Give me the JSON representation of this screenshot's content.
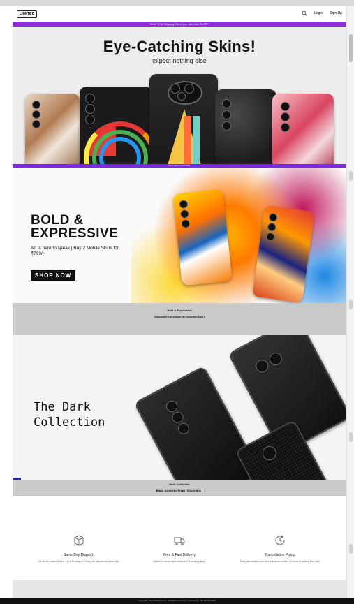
{
  "header": {
    "logo": "LIMITED",
    "login": "Login",
    "signup": "Sign Up"
  },
  "banner": {
    "shipping": "World Wide Shipping, Order your skin from Rs 299 !"
  },
  "hero1": {
    "title": "Eye-Catching Skins!",
    "subtitle": "expect nothing else"
  },
  "bestbar": {
    "text": "Best Skins of the Year"
  },
  "hero2": {
    "title_line1": "BOLD &",
    "title_line2": "EXPRESSIVE",
    "tagline": "Art is here to speak | Buy 2 Mobile Skins for ₹799/-",
    "cta": "SHOP NOW",
    "caption_title": "Bold & Expressive",
    "caption_text": "Colourfull collection for colorfull you !"
  },
  "hero3": {
    "title_line1": "The Dark",
    "title_line2": "Collection",
    "caption_title": "Dark Collection",
    "caption_text": "Black Aesthetic Freak?Check this !"
  },
  "features": [
    {
      "icon": "box-icon",
      "title": "Same Day Dispatch",
      "desc": "All orders placed before 12pm Monday to Friday are dispatched same day."
    },
    {
      "icon": "truck-icon",
      "title": "Free & Fast Delivery",
      "desc": "Orders to metro cities reach in 2-5 working days."
    },
    {
      "icon": "clock-icon",
      "title": "Cancellation Policy",
      "desc": "Easy cancellation from the dashboard within 12 hours of placing the order"
    }
  ],
  "footer": {
    "text": "Copyright © EyeletShop Store, All Rights Reserved. | Contact Us: +91 223 567 899"
  },
  "colors": {
    "accent_purple": "#8e2ee0",
    "caption_gray": "#c9c9c9",
    "footer_black": "#111111"
  }
}
